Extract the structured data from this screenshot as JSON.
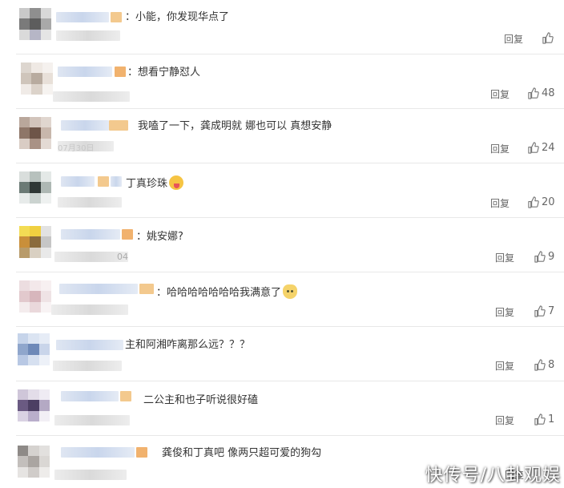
{
  "reply_label": "回复",
  "comments": [
    {
      "text": "：小能，你发现华点了",
      "likes": ""
    },
    {
      "text": "：想看宁静怼人",
      "likes": "48"
    },
    {
      "text": "我嗑了一下，龚成明就 娜也可以 真想安静",
      "likes": "24"
    },
    {
      "text": "丁真珍珠",
      "likes": "20",
      "emoji": "tongue-out-emoji"
    },
    {
      "text": "：姚安娜?",
      "likes": "9"
    },
    {
      "text": "：哈哈哈哈哈哈哈我满意了",
      "likes": "7",
      "emoji": "cat-emoji"
    },
    {
      "text": "主和阿湘咋离那么远？？？",
      "likes": "8"
    },
    {
      "text": "二公主和也子听说很好磕",
      "likes": "1"
    },
    {
      "text": "龚俊和丁真吧 像两只超可爱的狗勾",
      "likes": ""
    }
  ],
  "partial_meta": [
    "07月30日",
    "04"
  ],
  "watermark": "快传号/八卦观娱",
  "colors": {
    "text": "#333333",
    "muted": "#666666",
    "divider": "#e8e8e8",
    "tag": "#f3c98e"
  }
}
